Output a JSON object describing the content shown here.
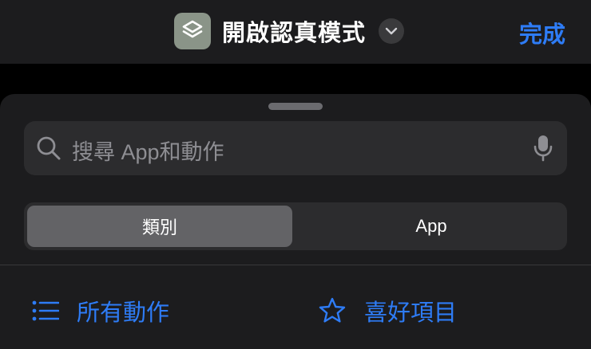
{
  "nav": {
    "title": "開啟認真模式",
    "done_label": "完成",
    "app_icon": "layers-icon",
    "accent_color": "#2e7cf6"
  },
  "search": {
    "placeholder": "搜尋 App和動作"
  },
  "segments": {
    "category_label": "類別",
    "apps_label": "App",
    "selected": "類別"
  },
  "filters": {
    "all_actions_label": "所有動作",
    "favorites_label": "喜好項目"
  }
}
